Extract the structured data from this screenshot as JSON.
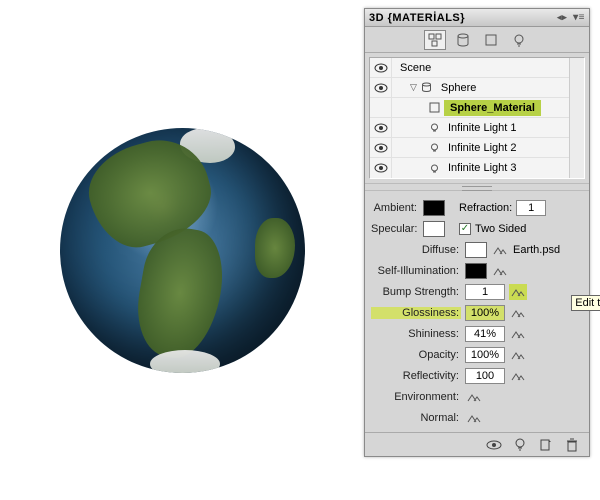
{
  "panel": {
    "title": "3D {MATERİALS}"
  },
  "scene": {
    "root": "Scene",
    "items": [
      {
        "label": "Sphere"
      },
      {
        "label": "Sphere_Material",
        "selected": true
      },
      {
        "label": "Infinite Light 1"
      },
      {
        "label": "Infinite Light 2"
      },
      {
        "label": "Infinite Light 3"
      }
    ]
  },
  "props": {
    "ambient_label": "Ambient:",
    "refraction_label": "Refraction:",
    "refraction_value": "1",
    "specular_label": "Specular:",
    "twosided_label": "Two Sided",
    "twosided_checked": "✓",
    "diffuse_label": "Diffuse:",
    "diffuse_file": "Earth.psd",
    "selfillum_label": "Self-Illumination:",
    "bump_label": "Bump Strength:",
    "bump_value": "1",
    "gloss_label": "Glossiness:",
    "gloss_value": "100%",
    "shine_label": "Shininess:",
    "shine_value": "41%",
    "opacity_label": "Opacity:",
    "opacity_value": "100%",
    "reflect_label": "Reflectivity:",
    "reflect_value": "100",
    "env_label": "Environment:",
    "normal_label": "Normal:"
  },
  "tooltip": "Edit the bum"
}
